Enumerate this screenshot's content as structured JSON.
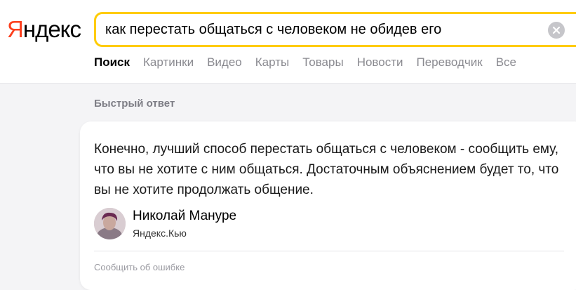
{
  "logo": {
    "first_letter": "Я",
    "rest": "ндекс"
  },
  "search": {
    "query": "как перестать общаться с человеком не обидев его"
  },
  "tabs": [
    {
      "label": "Поиск"
    },
    {
      "label": "Картинки"
    },
    {
      "label": "Видео"
    },
    {
      "label": "Карты"
    },
    {
      "label": "Товары"
    },
    {
      "label": "Новости"
    },
    {
      "label": "Переводчик"
    },
    {
      "label": "Все"
    }
  ],
  "section": {
    "label": "Быстрый ответ"
  },
  "answer": {
    "text": "Конечно, лучший способ перестать общаться с человеком - сообщить ему, что вы не хотите с ним общаться. Достаточным объяснением будет то, что вы не хотите продолжать общение.",
    "author_name": "Николай Мануре",
    "author_source": "Яндекс.Кью",
    "report_label": "Сообщить об ошибке"
  },
  "colors": {
    "brand_red": "#fc3f1d",
    "search_border": "#ffcc00"
  }
}
